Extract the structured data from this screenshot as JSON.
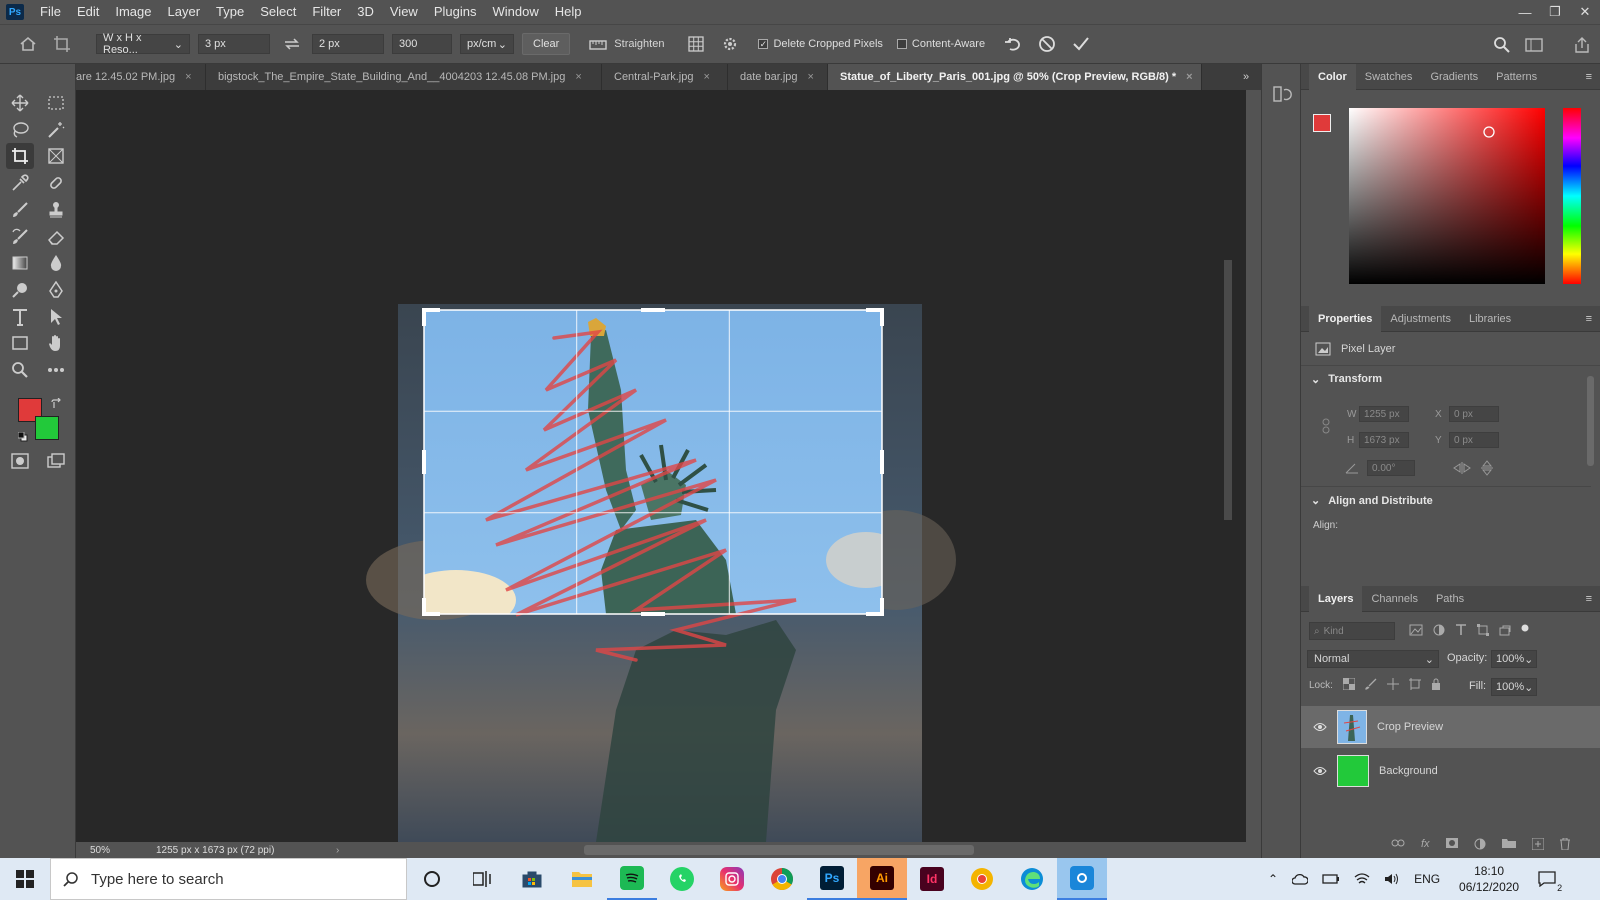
{
  "app": {
    "logo_text": "Ps"
  },
  "menubar": {
    "items": [
      "File",
      "Edit",
      "Image",
      "Layer",
      "Type",
      "Select",
      "Filter",
      "3D",
      "View",
      "Plugins",
      "Window",
      "Help"
    ]
  },
  "window_controls": {
    "minimize": "—",
    "restore": "❐",
    "close": "✕"
  },
  "options_bar": {
    "ratio_select": "W x H x Reso...",
    "width_value": "3 px",
    "height_value": "2 px",
    "resolution_value": "300",
    "resolution_unit": "px/cm",
    "clear_label": "Clear",
    "straighten_label": "Straighten",
    "delete_cropped_label": "Delete Cropped Pixels",
    "delete_cropped_checked": true,
    "content_aware_label": "Content-Aware",
    "content_aware_checked": false
  },
  "tabs": [
    {
      "label": "are 12.45.02 PM.jpg",
      "active": false
    },
    {
      "label": "bigstock_The_Empire_State_Building_And__4004203 12.45.08 PM.jpg",
      "active": false
    },
    {
      "label": "Central-Park.jpg",
      "active": false
    },
    {
      "label": "date bar.jpg",
      "active": false
    },
    {
      "label": "Statue_of_Liberty_Paris_001.jpg @ 50% (Crop Preview, RGB/8) *",
      "active": true
    }
  ],
  "tab_close_glyph": "×",
  "colors": {
    "foreground": "#e03a3a",
    "background": "#22c93a",
    "sky": "#7fb4e6",
    "scribble": "#e04646"
  },
  "status": {
    "zoom": "50%",
    "doc_info": "1255 px x 1673 px (72 ppi)"
  },
  "color_panel": {
    "tabs": [
      "Color",
      "Swatches",
      "Gradients",
      "Patterns"
    ],
    "active_tab": "Color"
  },
  "properties_panel": {
    "tabs": [
      "Properties",
      "Adjustments",
      "Libraries"
    ],
    "active_tab": "Properties",
    "layer_type": "Pixel Layer",
    "transform_heading": "Transform",
    "w_label": "W",
    "w_value": "1255 px",
    "h_label": "H",
    "h_value": "1673 px",
    "x_label": "X",
    "x_value": "0 px",
    "y_label": "Y",
    "y_value": "0 px",
    "angle_value": "0.00°",
    "align_heading": "Align and Distribute",
    "align_label": "Align:"
  },
  "layers_panel": {
    "tabs": [
      "Layers",
      "Channels",
      "Paths"
    ],
    "active_tab": "Layers",
    "filter_placeholder": "Kind",
    "blend_mode": "Normal",
    "opacity_label": "Opacity:",
    "opacity_value": "100%",
    "lock_label": "Lock:",
    "fill_label": "Fill:",
    "fill_value": "100%",
    "layers": [
      {
        "name": "Crop Preview",
        "selected": true
      },
      {
        "name": "Background",
        "selected": false
      }
    ]
  },
  "taskbar": {
    "search_placeholder": "Type here to search",
    "apps": [
      "cortana-icon",
      "task-view-icon",
      "store-icon",
      "file-explorer-icon",
      "spotify-icon",
      "whatsapp-icon",
      "instagram-icon",
      "chrome-icon",
      "photoshop-icon",
      "illustrator-icon",
      "indesign-icon",
      "chrome-canary-icon",
      "edge-icon",
      "app-icon"
    ],
    "ps_label": "Ps",
    "ai_label": "Ai",
    "id_label": "Id",
    "lang": "ENG",
    "time": "18:10",
    "date": "06/12/2020",
    "notif_count": "2"
  }
}
